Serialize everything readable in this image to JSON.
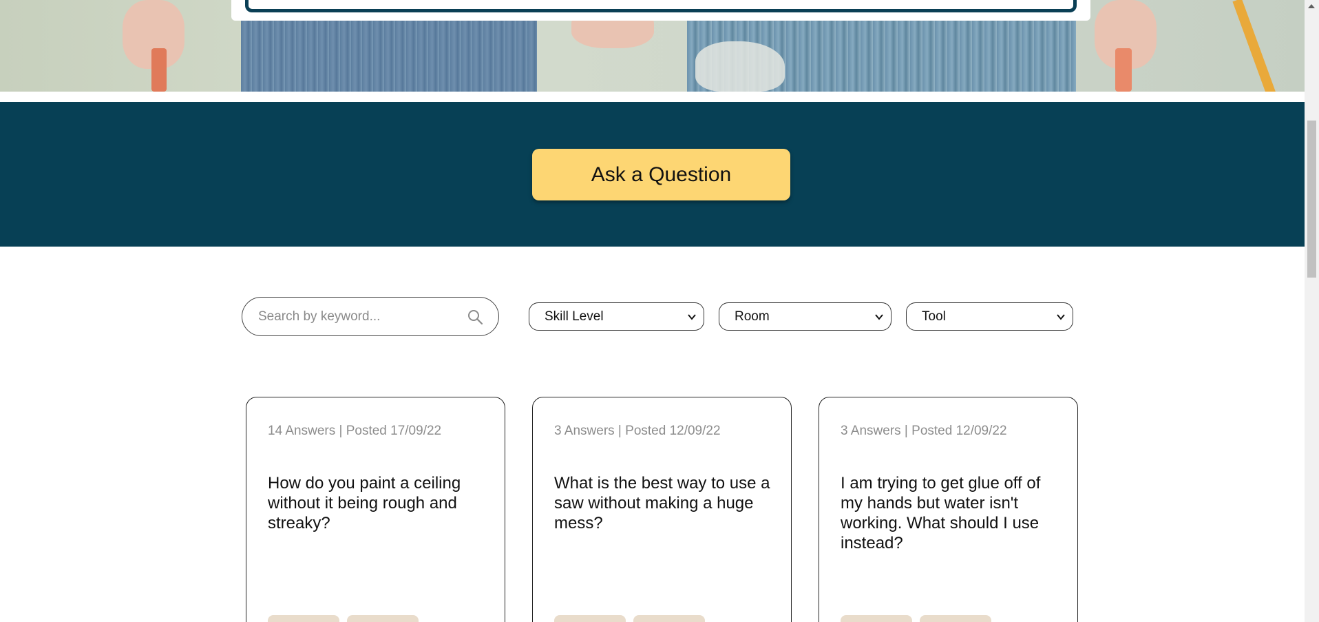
{
  "hero": {
    "image_alt": "people in jeans holding paint brushes"
  },
  "cta": {
    "ask_label": "Ask a Question",
    "band_color": "#074055",
    "button_color": "#fdd673"
  },
  "filters": {
    "search_placeholder": "Search by keyword...",
    "search_icon": "search-icon",
    "skill_level": "Skill Level",
    "room": "Room",
    "tool": "Tool"
  },
  "cards": [
    {
      "meta": "14 Answers | Posted 17/09/22",
      "question": "How do you paint a ceiling without it being rough and streaky?"
    },
    {
      "meta": "3 Answers | Posted 12/09/22",
      "question": "What is the best way to use a saw without making a huge mess?"
    },
    {
      "meta": "3 Answers | Posted 12/09/22",
      "question": "I am trying to get glue off of my hands but water isn't working. What should I use instead?"
    }
  ]
}
